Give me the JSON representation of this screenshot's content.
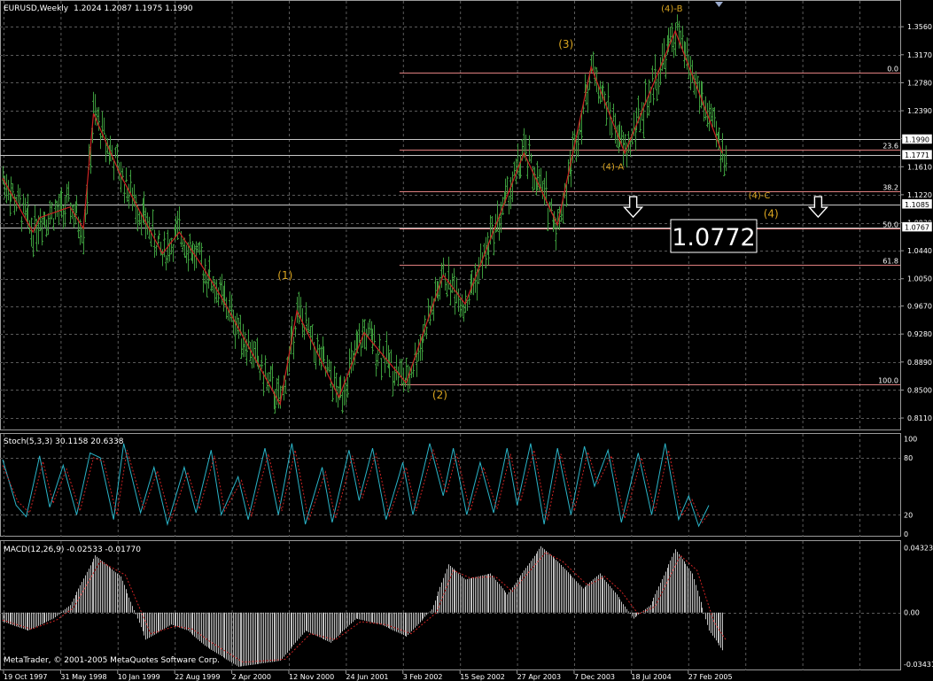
{
  "window": {
    "title": "EURUSD,Weekly",
    "ohlc": "1.2024 1.2087 1.1975 1.1990",
    "copyright": "MetaTrader, © 2001-2005 MetaQuotes Software Corp."
  },
  "colors": {
    "background": "#000000",
    "grid": "#5a5a5a",
    "bars": "#3c9a3c",
    "wave_lines": "#cc2222",
    "fib_lines": "#e08080",
    "hlines": "#c8c8c8",
    "labels": "#daa520",
    "stoch_main": "#2ab4c8",
    "stoch_signal": "#cc2222",
    "macd_hist": "#c0c0c0",
    "macd_signal": "#cc2222"
  },
  "chart_data": [
    {
      "type": "line",
      "panel": "price",
      "title": "EURUSD,Weekly",
      "ylim": [
        0.795,
        1.392
      ],
      "y_ticks": [
        "1.3560",
        "1.3170",
        "1.2780",
        "1.2390",
        "1.2000",
        "1.1610",
        "1.1220",
        "1.0830",
        "1.0440",
        "1.0050",
        "0.9670",
        "0.9280",
        "0.8890",
        "0.8500",
        "0.8110"
      ],
      "x_tick_labels": [
        "19 Oct 1997",
        "31 May 1998",
        "10 Jan 1999",
        "22 Aug 1999",
        "2 Apr 2000",
        "12 Nov 2000",
        "24 Jun 2001",
        "3 Feb 2002",
        "15 Sep 2002",
        "27 Apr 2003",
        "7 Dec 2003",
        "18 Jul 2004",
        "27 Feb 2005"
      ],
      "x_range": [
        0,
        430
      ],
      "wave_points": [
        [
          0,
          1.145
        ],
        [
          18,
          1.07
        ],
        [
          22,
          1.09
        ],
        [
          40,
          1.105
        ],
        [
          48,
          1.075
        ],
        [
          54,
          1.235
        ],
        [
          70,
          1.15
        ],
        [
          95,
          1.04
        ],
        [
          105,
          1.07
        ],
        [
          118,
          1.025
        ],
        [
          130,
          0.98
        ],
        [
          165,
          0.83
        ],
        [
          175,
          0.96
        ],
        [
          200,
          0.84
        ],
        [
          215,
          0.93
        ],
        [
          240,
          0.86
        ],
        [
          262,
          1.01
        ],
        [
          275,
          0.97
        ],
        [
          310,
          1.18
        ],
        [
          330,
          1.08
        ],
        [
          350,
          1.3
        ],
        [
          370,
          1.18
        ],
        [
          400,
          1.35
        ],
        [
          428,
          1.18
        ]
      ],
      "price_boxes": [
        {
          "label": "1.1990",
          "value": 1.199
        },
        {
          "label": "1.1771",
          "value": 1.1771
        },
        {
          "label": "1.1085",
          "value": 1.1085
        },
        {
          "label": "1.0767",
          "value": 1.0767
        }
      ],
      "horizontal_lines": [
        1.199,
        1.1771,
        1.1085,
        1.0767
      ],
      "fibonacci": {
        "high": 1.2927,
        "low": 0.8578,
        "x_start": 236,
        "levels": [
          {
            "label": "0.0",
            "value": 1.2927
          },
          {
            "label": "23.6",
            "value": 1.1853
          },
          {
            "label": "38.2",
            "value": 1.1262
          },
          {
            "label": "50.0",
            "value": 1.0753
          },
          {
            "label": "61.8",
            "value": 1.0244
          },
          {
            "label": "100.0",
            "value": 0.8578
          }
        ]
      },
      "annotations": [
        {
          "text": "(1)",
          "x": 168,
          "y": 1.0045,
          "style": "wave"
        },
        {
          "text": "(2)",
          "x": 260,
          "y": 0.838,
          "style": "wave"
        },
        {
          "text": "(3)",
          "x": 335,
          "y": 1.3266,
          "style": "wave"
        },
        {
          "text": "(4)-B",
          "x": 398,
          "y": 1.3772,
          "style": "wave-s"
        },
        {
          "text": "(4)-A",
          "x": 363,
          "y": 1.1569,
          "style": "wave-s"
        },
        {
          "text": "(4)-C",
          "x": 450,
          "y": 1.1169,
          "style": "wave-s"
        },
        {
          "text": "(4)",
          "x": 457,
          "y": 1.0902,
          "style": "wave"
        }
      ],
      "target_label": "1.0772",
      "arrows": [
        {
          "x": 375,
          "y": 1.1045
        },
        {
          "x": 485,
          "y": 1.1045
        }
      ]
    },
    {
      "type": "line",
      "panel": "stochastic",
      "title": "Stoch(5,3,3) 30.1158 20.6338",
      "ylim": [
        -3,
        105
      ],
      "y_ticks": [
        "100",
        "80",
        "20",
        "0"
      ],
      "series": [
        {
          "name": "main",
          "pivots": [
            [
              0,
              78
            ],
            [
              8,
              30
            ],
            [
              14,
              18
            ],
            [
              22,
              82
            ],
            [
              28,
              28
            ],
            [
              36,
              72
            ],
            [
              44,
              20
            ],
            [
              52,
              85
            ],
            [
              58,
              80
            ],
            [
              66,
              15
            ],
            [
              72,
              95
            ],
            [
              82,
              22
            ],
            [
              90,
              70
            ],
            [
              98,
              10
            ],
            [
              108,
              70
            ],
            [
              115,
              22
            ],
            [
              124,
              88
            ],
            [
              130,
              20
            ],
            [
              140,
              60
            ],
            [
              146,
              15
            ],
            [
              156,
              90
            ],
            [
              164,
              20
            ],
            [
              172,
              95
            ],
            [
              180,
              10
            ],
            [
              190,
              70
            ],
            [
              196,
              12
            ],
            [
              206,
              88
            ],
            [
              212,
              35
            ],
            [
              220,
              90
            ],
            [
              228,
              15
            ],
            [
              238,
              75
            ],
            [
              244,
              20
            ],
            [
              254,
              95
            ],
            [
              262,
              40
            ],
            [
              268,
              90
            ],
            [
              276,
              20
            ],
            [
              284,
              75
            ],
            [
              292,
              22
            ],
            [
              300,
              90
            ],
            [
              306,
              30
            ],
            [
              314,
              95
            ],
            [
              322,
              10
            ],
            [
              330,
              90
            ],
            [
              338,
              20
            ],
            [
              346,
              92
            ],
            [
              352,
              50
            ],
            [
              360,
              88
            ],
            [
              368,
              12
            ],
            [
              378,
              85
            ],
            [
              386,
              20
            ],
            [
              394,
              95
            ],
            [
              402,
              15
            ],
            [
              408,
              40
            ],
            [
              414,
              8
            ],
            [
              420,
              30
            ]
          ]
        },
        {
          "name": "signal",
          "pivots": [
            [
              0,
              72
            ],
            [
              9,
              34
            ],
            [
              16,
              22
            ],
            [
              24,
              76
            ],
            [
              30,
              32
            ],
            [
              38,
              68
            ],
            [
              46,
              24
            ],
            [
              54,
              80
            ],
            [
              60,
              76
            ],
            [
              68,
              20
            ],
            [
              74,
              88
            ],
            [
              84,
              26
            ],
            [
              92,
              66
            ],
            [
              100,
              14
            ],
            [
              110,
              65
            ],
            [
              117,
              26
            ],
            [
              126,
              82
            ],
            [
              132,
              24
            ],
            [
              142,
              56
            ],
            [
              148,
              19
            ],
            [
              158,
              84
            ],
            [
              166,
              24
            ],
            [
              174,
              88
            ],
            [
              182,
              14
            ],
            [
              192,
              65
            ],
            [
              198,
              16
            ],
            [
              208,
              82
            ],
            [
              214,
              38
            ],
            [
              222,
              84
            ],
            [
              230,
              19
            ],
            [
              240,
              70
            ],
            [
              246,
              24
            ],
            [
              256,
              88
            ],
            [
              264,
              43
            ],
            [
              270,
              84
            ],
            [
              278,
              24
            ],
            [
              286,
              70
            ],
            [
              294,
              26
            ],
            [
              302,
              84
            ],
            [
              308,
              34
            ],
            [
              316,
              88
            ],
            [
              324,
              14
            ],
            [
              332,
              84
            ],
            [
              340,
              24
            ],
            [
              348,
              86
            ],
            [
              354,
              53
            ],
            [
              362,
              82
            ],
            [
              370,
              16
            ],
            [
              380,
              80
            ],
            [
              388,
              24
            ],
            [
              396,
              88
            ],
            [
              404,
              19
            ],
            [
              410,
              36
            ],
            [
              416,
              12
            ],
            [
              420,
              21
            ]
          ]
        }
      ]
    },
    {
      "type": "bar",
      "panel": "macd",
      "title": "MACD(12,26,9) -0.02533 -0.01770",
      "ylim": [
        -0.0384,
        0.0475
      ],
      "y_ticks": [
        "0.04323",
        "0.00",
        "-0.03431"
      ],
      "series": [
        {
          "name": "histogram",
          "pivots": [
            [
              0,
              -0.006
            ],
            [
              15,
              -0.012
            ],
            [
              30,
              -0.004
            ],
            [
              40,
              0.005
            ],
            [
              55,
              0.038
            ],
            [
              70,
              0.024
            ],
            [
              85,
              -0.018
            ],
            [
              100,
              -0.008
            ],
            [
              110,
              -0.012
            ],
            [
              120,
              -0.022
            ],
            [
              140,
              -0.036
            ],
            [
              165,
              -0.032
            ],
            [
              180,
              -0.012
            ],
            [
              195,
              -0.02
            ],
            [
              210,
              -0.004
            ],
            [
              225,
              -0.008
            ],
            [
              240,
              -0.016
            ],
            [
              255,
              0.002
            ],
            [
              265,
              0.032
            ],
            [
              275,
              0.022
            ],
            [
              290,
              0.026
            ],
            [
              300,
              0.012
            ],
            [
              320,
              0.044
            ],
            [
              330,
              0.034
            ],
            [
              345,
              0.016
            ],
            [
              355,
              0.026
            ],
            [
              365,
              0.012
            ],
            [
              375,
              -0.004
            ],
            [
              385,
              0.005
            ],
            [
              400,
              0.042
            ],
            [
              410,
              0.026
            ],
            [
              420,
              -0.012
            ],
            [
              428,
              -0.025
            ]
          ]
        },
        {
          "name": "signal",
          "pivots": [
            [
              0,
              -0.005
            ],
            [
              17,
              -0.011
            ],
            [
              32,
              -0.005
            ],
            [
              42,
              0.003
            ],
            [
              58,
              0.034
            ],
            [
              73,
              0.025
            ],
            [
              88,
              -0.014
            ],
            [
              103,
              -0.009
            ],
            [
              113,
              -0.011
            ],
            [
              123,
              -0.019
            ],
            [
              143,
              -0.033
            ],
            [
              168,
              -0.031
            ],
            [
              183,
              -0.014
            ],
            [
              198,
              -0.018
            ],
            [
              213,
              -0.006
            ],
            [
              228,
              -0.008
            ],
            [
              243,
              -0.014
            ],
            [
              258,
              0.0
            ],
            [
              268,
              0.028
            ],
            [
              278,
              0.023
            ],
            [
              293,
              0.024
            ],
            [
              303,
              0.014
            ],
            [
              323,
              0.04
            ],
            [
              333,
              0.034
            ],
            [
              348,
              0.018
            ],
            [
              358,
              0.024
            ],
            [
              368,
              0.014
            ],
            [
              378,
              -0.001
            ],
            [
              388,
              0.004
            ],
            [
              403,
              0.038
            ],
            [
              413,
              0.028
            ],
            [
              423,
              -0.006
            ],
            [
              430,
              -0.018
            ]
          ]
        }
      ]
    }
  ]
}
